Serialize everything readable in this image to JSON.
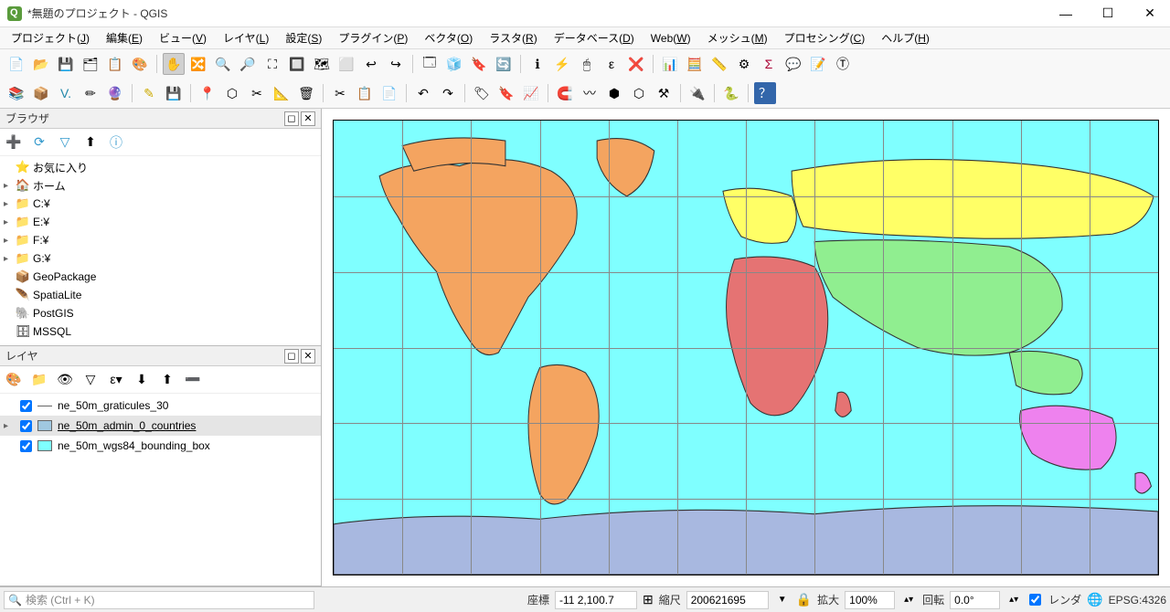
{
  "window": {
    "title": "*無題のプロジェクト - QGIS"
  },
  "menu": {
    "items": [
      {
        "label": "プロジェクト",
        "key": "J"
      },
      {
        "label": "編集",
        "key": "E"
      },
      {
        "label": "ビュー",
        "key": "V"
      },
      {
        "label": "レイヤ",
        "key": "L"
      },
      {
        "label": "設定",
        "key": "S"
      },
      {
        "label": "プラグイン",
        "key": "P"
      },
      {
        "label": "ベクタ",
        "key": "O"
      },
      {
        "label": "ラスタ",
        "key": "R"
      },
      {
        "label": "データベース",
        "key": "D"
      },
      {
        "label": "Web",
        "key": "W"
      },
      {
        "label": "メッシュ",
        "key": "M"
      },
      {
        "label": "プロセシング",
        "key": "C"
      },
      {
        "label": "ヘルプ",
        "key": "H"
      }
    ]
  },
  "browser": {
    "title": "ブラウザ",
    "items": [
      {
        "icon": "⭐",
        "label": "お気に入り",
        "expand": ""
      },
      {
        "icon": "🏠",
        "label": "ホーム",
        "expand": "▸"
      },
      {
        "icon": "📁",
        "label": "C:¥",
        "expand": "▸"
      },
      {
        "icon": "📁",
        "label": "E:¥",
        "expand": "▸"
      },
      {
        "icon": "📁",
        "label": "F:¥",
        "expand": "▸"
      },
      {
        "icon": "📁",
        "label": "G:¥",
        "expand": "▸"
      },
      {
        "icon": "📦",
        "label": "GeoPackage",
        "expand": ""
      },
      {
        "icon": "🪶",
        "label": "SpatiaLite",
        "expand": ""
      },
      {
        "icon": "🐘",
        "label": "PostGIS",
        "expand": ""
      },
      {
        "icon": "🗄",
        "label": "MSSQL",
        "expand": ""
      }
    ]
  },
  "layers": {
    "title": "レイヤ",
    "items": [
      {
        "name": "ne_50m_graticules_30",
        "checked": true,
        "expand": "",
        "swatch": "#ffffff",
        "underline": false,
        "swatchStyle": "line"
      },
      {
        "name": "ne_50m_admin_0_countries",
        "checked": true,
        "expand": "▸",
        "swatch": "#a0c8e0",
        "underline": true,
        "selected": true,
        "swatchStyle": "poly"
      },
      {
        "name": "ne_50m_wgs84_bounding_box",
        "checked": true,
        "expand": "",
        "swatch": "#7fffff",
        "underline": false,
        "swatchStyle": "box"
      }
    ]
  },
  "status": {
    "search_placeholder": "検索 (Ctrl + K)",
    "coord_label": "座標",
    "coord_value": "-11 2,100.7",
    "scale_label": "縮尺",
    "scale_value": "200621695",
    "magnify_label": "拡大",
    "magnify_value": "100%",
    "rotation_label": "回転",
    "rotation_value": "0.0°",
    "render_label": "レンダ",
    "crs": "EPSG:4326"
  }
}
